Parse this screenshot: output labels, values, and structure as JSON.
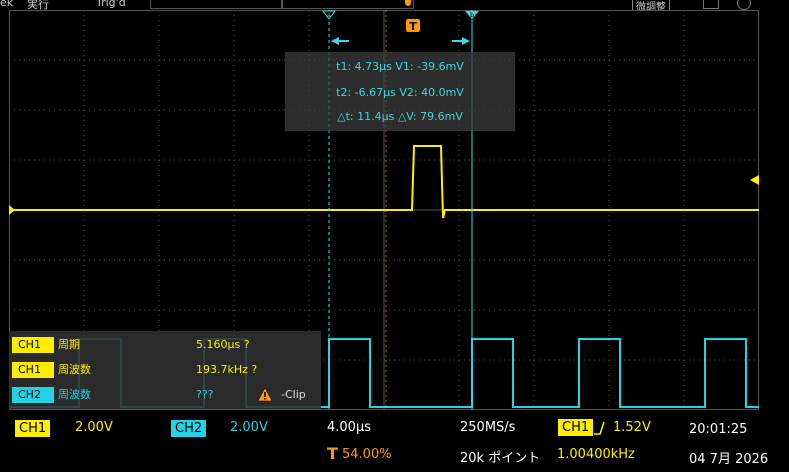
{
  "colors": {
    "ch1": "#ffee00",
    "ch2": "#22d3e6",
    "cursor": "#3fd6e0",
    "trigger": "#ff9900",
    "grid": "#555555"
  },
  "topbar": {
    "left_label": "ek",
    "run_label": "実行",
    "trig_label": "Trig'd",
    "right_button": "微調整"
  },
  "cursor": {
    "t1_readout": "t1: 4.73µs  V1: -39.6mV",
    "t2_readout": "t2: -6.67µs  V2: 40.0mV",
    "delta_readout": "△t: 11.4µs  △V: 79.6mV",
    "marker_a": "a",
    "marker_b": "b"
  },
  "trigger_marker": "T",
  "measurements": [
    {
      "channel": "CH1",
      "label": "周期",
      "value": "5.160µs  ?"
    },
    {
      "channel": "CH1",
      "label": "周波数",
      "value": "193.7kHz  ?"
    },
    {
      "channel": "CH2",
      "label": "周波数",
      "value": "???",
      "warning": "-Clip"
    }
  ],
  "status": {
    "ch1_label": "CH1",
    "ch1_scale": "2.00V",
    "ch2_label": "CH2",
    "ch2_scale": "2.00V",
    "timebase": "4.00µs",
    "trigger_pos_symbol": "T",
    "trigger_pos": "54.00%",
    "sample_rate": "250MS/s",
    "record_length": "20k ポイント",
    "trig_source": "CH1",
    "trig_level": "1.52V",
    "trig_freq": "1.00400kHz",
    "time": "20:01:25",
    "date": "04 7月 2026"
  }
}
